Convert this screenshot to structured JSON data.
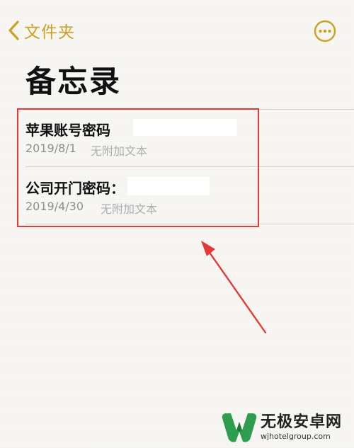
{
  "colors": {
    "accent": "#c9a227",
    "highlight": "#e53935",
    "background": "#f8f7f3",
    "secondary_text": "#8e8e93",
    "tertiary_text": "#aeaeb2"
  },
  "nav": {
    "back_label": "文件夹",
    "back_icon": "chevron-left-icon",
    "more_icon": "ellipsis-circle-icon"
  },
  "page": {
    "title": "备忘录"
  },
  "notes": [
    {
      "title": "苹果账号密码",
      "date": "2019/8/1",
      "preview": "无附加文本"
    },
    {
      "title": "公司开门密码：",
      "date": "2019/4/30",
      "preview": "无附加文本"
    }
  ],
  "watermark": {
    "name": "无极安卓网",
    "url": "wjhotelgroup.com"
  }
}
